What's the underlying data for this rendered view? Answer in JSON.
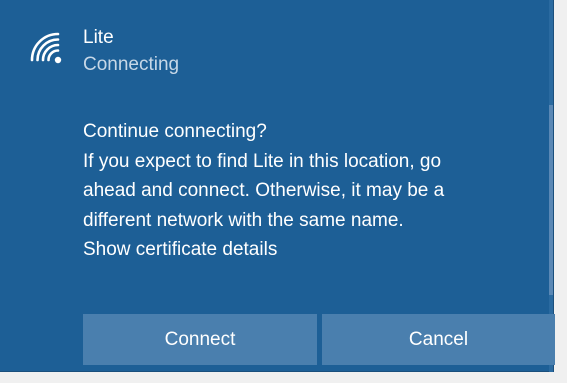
{
  "network": {
    "name": "Lite",
    "status": "Connecting",
    "icon": "wifi-secured-icon"
  },
  "prompt": {
    "question": "Continue connecting?",
    "body_lines": [
      "If you expect to find Lite in this location, go",
      "ahead and connect. Otherwise, it may be a",
      "different network with the same name."
    ],
    "certificate_link": "Show certificate details"
  },
  "buttons": {
    "connect": "Connect",
    "cancel": "Cancel"
  },
  "colors": {
    "panel_background": "#1d5f96",
    "button_background": "#4a7fae",
    "secondary_text": "#c6d7e7"
  }
}
